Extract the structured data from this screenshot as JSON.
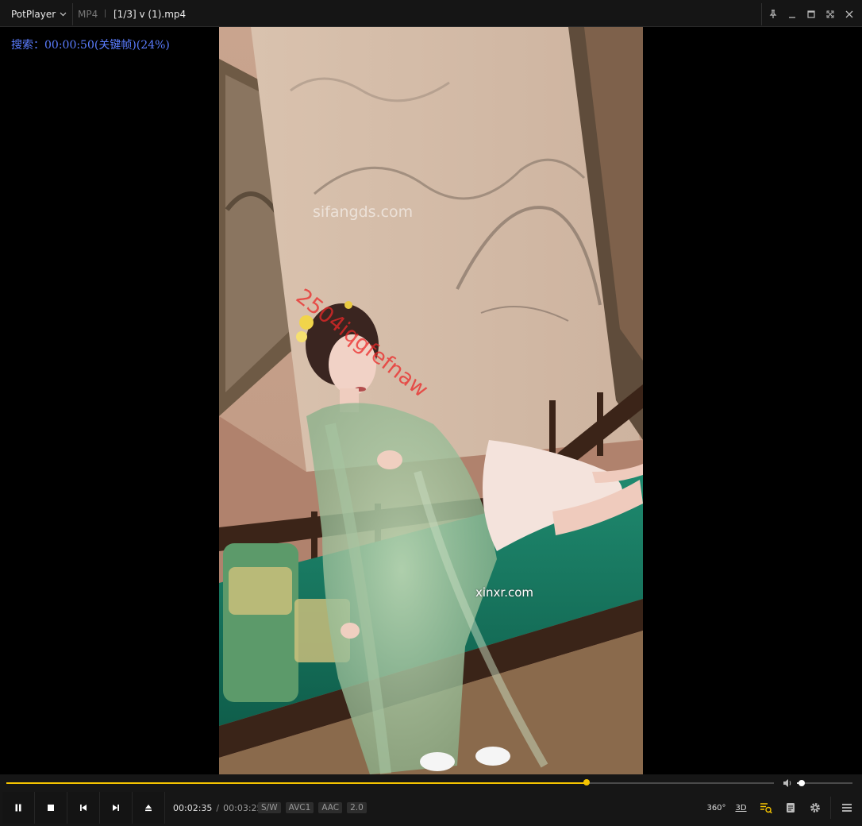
{
  "titlebar": {
    "app_name": "PotPlayer",
    "format": "MP4",
    "file": "[1/3] v (1).mp4"
  },
  "osd": {
    "text": "搜索：00:00:50(关键帧)(24%)"
  },
  "video": {
    "watermark_site": "sifangds.com",
    "watermark_code": "2504iqgfefnaw",
    "watermark_brand": "xinxr.com"
  },
  "controls": {
    "position": "00:02:35",
    "separator": "/",
    "duration": "00:03:25",
    "progress_fraction": 0.756,
    "volume_fraction": 0.08,
    "badges": [
      "S/W",
      "AVC1",
      "AAC",
      "2.0"
    ],
    "btn_360": "360°",
    "btn_3d": "3D",
    "accent_color": "#f5c400"
  }
}
